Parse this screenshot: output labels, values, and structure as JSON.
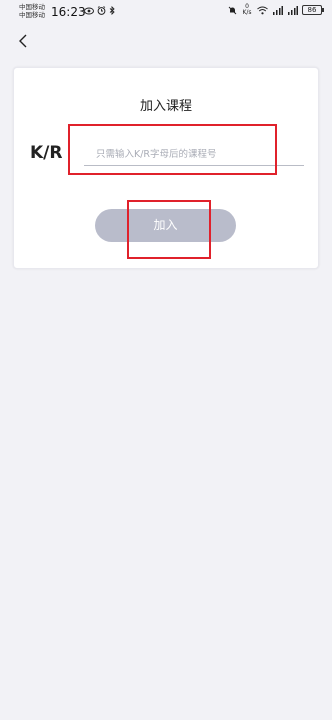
{
  "status_bar": {
    "carrier_1": "中国移动",
    "carrier_2": "中国移动",
    "time": "16:23",
    "speed_value": "0",
    "speed_unit": "K/s",
    "battery": "86"
  },
  "nav": {
    "back_icon": "chevron-left-icon"
  },
  "card": {
    "title": "加入课程",
    "prefix_label": "K/R",
    "course_input": {
      "value": "",
      "placeholder": "只需输入K/R字母后的课程号"
    },
    "join_label": "加入"
  },
  "colors": {
    "background": "#f2f2f6",
    "card": "#ffffff",
    "button_disabled": "#b9bccb",
    "highlight": "#e0212b"
  }
}
